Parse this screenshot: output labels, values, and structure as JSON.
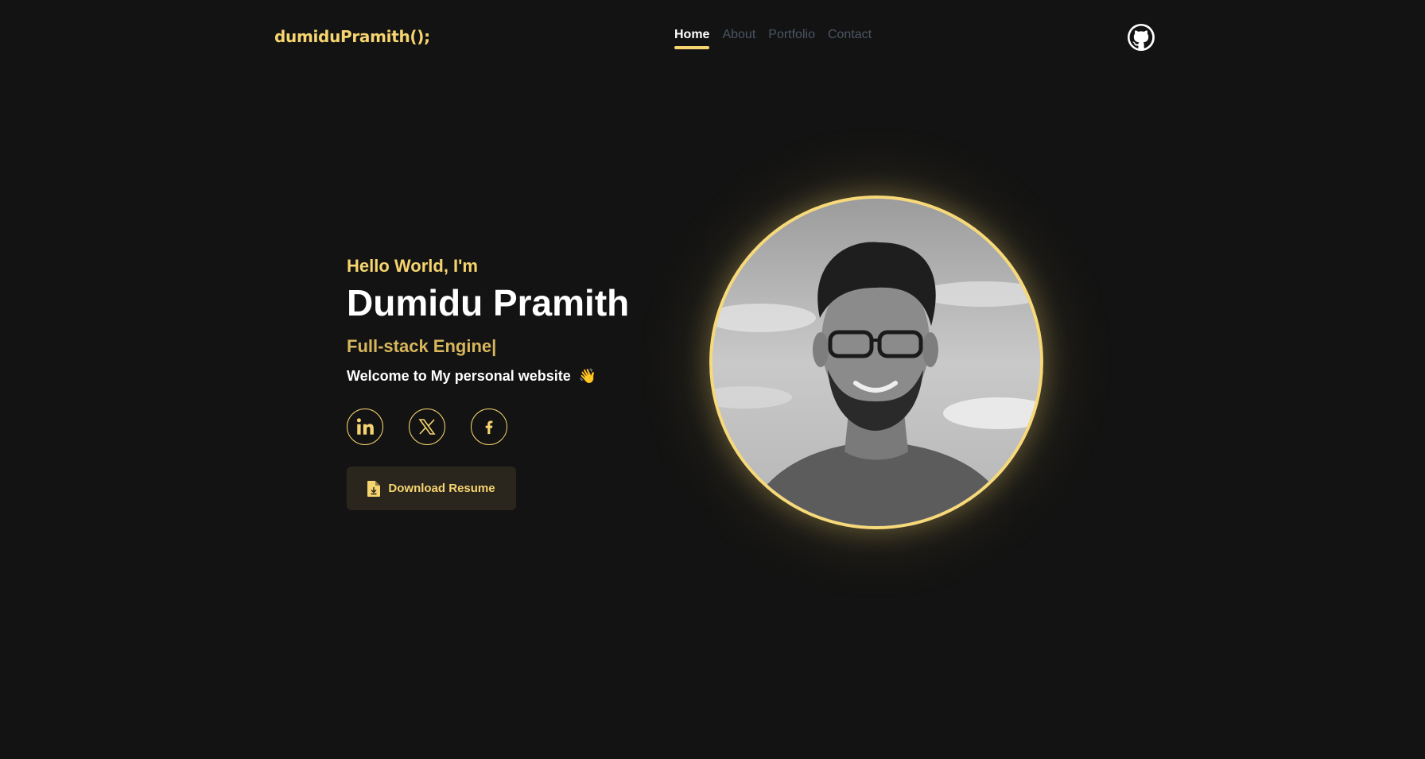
{
  "header": {
    "logo": "dumiduPramith();",
    "nav": [
      {
        "label": "Home",
        "active": true
      },
      {
        "label": "About",
        "active": false
      },
      {
        "label": "Portfolio",
        "active": false
      },
      {
        "label": "Contact",
        "active": false
      }
    ],
    "github_icon": "github-icon"
  },
  "hero": {
    "greeting": "Hello World, I'm",
    "name": "Dumidu Pramith",
    "role": "Full-stack Engine|",
    "welcome": "Welcome to My personal website",
    "wave_emoji": "👋",
    "socials": [
      {
        "icon": "linkedin-icon"
      },
      {
        "icon": "x-icon"
      },
      {
        "icon": "facebook-icon"
      }
    ],
    "resume_label": "Download Resume",
    "resume_icon": "file-download-icon"
  },
  "colors": {
    "background": "#131313",
    "accent": "#f6d46f",
    "nav_inactive": "#4b5563"
  }
}
